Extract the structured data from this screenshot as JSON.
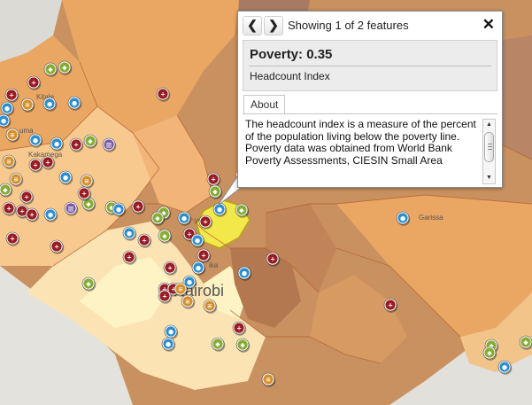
{
  "map": {
    "places": {
      "kitale": "Kitale",
      "kakamega": "Kakamega",
      "nairobi": "Nairobi",
      "garissa": "Garissa",
      "nyeri_fragment": "yer",
      "thika_fragment": "ika",
      "kisumu_fragment": "uma"
    },
    "colors": {
      "poverty_darkest": "#a67a63",
      "poverty_dark": "#c9915f",
      "poverty_mid": "#eaa663",
      "poverty_light": "#f7c98f",
      "poverty_lighter": "#fbe3b4",
      "poverty_lowest": "#fdf3c4",
      "selected_feature": "#f3e84a",
      "marker_health": "#9b1b23",
      "marker_water": "#2d8fd0",
      "marker_education": "#86ad34",
      "marker_ngo": "#d6902b",
      "marker_other": "#7a5aa7"
    }
  },
  "popup": {
    "prev_icon": "chevron-left-icon",
    "next_icon": "chevron-right-icon",
    "prev_symbol": "❮",
    "next_symbol": "❯",
    "close_symbol": "✕",
    "status": "Showing 1 of 2 features",
    "title": "Poverty: 0.35",
    "subtitle": "Headcount Index",
    "tab_label": "About",
    "content": "The headcount index is a measure of the percent of the population living below the poverty line. Poverty data was obtained from World Bank Poverty Assessments, CIESIN Small Area",
    "scroll_up": "▲",
    "scroll_down": "▼"
  }
}
